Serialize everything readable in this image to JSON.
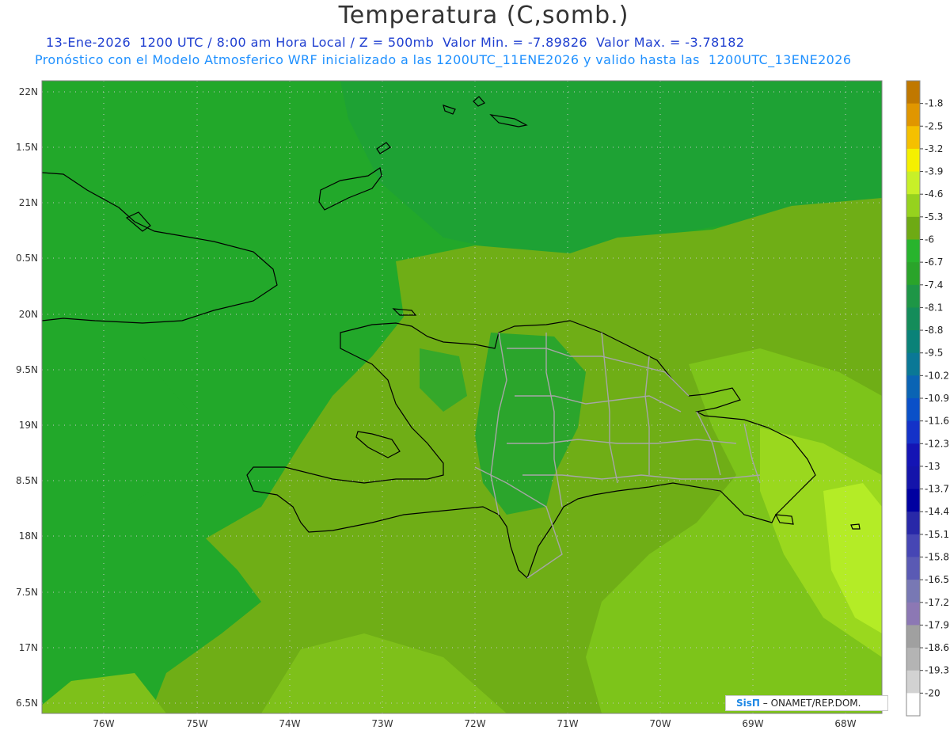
{
  "header": {
    "title": "Temperatura (C,somb.)",
    "subtitle_line1": "13-Ene-2026  1200 UTC / 8:00 am Hora Local / Z = 500mb  Valor Min. = -7.89826  Valor Max. = -3.78182",
    "subtitle_line2": "Pronóstico con el Modelo Atmosferico WRF inicializado a las 1200UTC_11ENE2026 y valido hasta las  1200UTC_13ENE2026"
  },
  "map": {
    "lat_labels": [
      "22N",
      "1.5N",
      "21N",
      "0.5N",
      "20N",
      "9.5N",
      "19N",
      "8.5N",
      "18N",
      "7.5N",
      "17N",
      "6.5N"
    ],
    "lon_labels": [
      "76W",
      "75W",
      "74W",
      "73W",
      "72W",
      "71W",
      "70W",
      "69W",
      "68W"
    ],
    "credit_logo": "SisΠ",
    "credit_text": " – ONAMET/REP.DOM."
  },
  "colorbar": {
    "levels": [
      "-1.8",
      "-2.5",
      "-3.2",
      "-3.9",
      "-4.6",
      "-5.3",
      "-6",
      "-6.7",
      "-7.4",
      "-8.1",
      "-8.8",
      "-9.5",
      "-10.2",
      "-10.9",
      "-11.6",
      "-12.3",
      "-13",
      "-13.7",
      "-14.4",
      "-15.1",
      "-15.8",
      "-16.5",
      "-17.2",
      "-17.9",
      "-18.6",
      "-19.3",
      "-20"
    ],
    "colors": [
      "#c07800",
      "#e09600",
      "#f5c000",
      "#f5f000",
      "#c8f028",
      "#96d21e",
      "#6eaa14",
      "#28b42d",
      "#2aa42a",
      "#1e9646",
      "#148c5a",
      "#0a8278",
      "#0a7896",
      "#0a64b4",
      "#0a50c8",
      "#1432c8",
      "#1414b4",
      "#1414aa",
      "#0000a0",
      "#2828a8",
      "#4646b4",
      "#5a5ab4",
      "#7878b4",
      "#8c78b4",
      "#a0a0a0",
      "#b4b4b4",
      "#d2d2d2",
      "#ffffff"
    ]
  }
}
